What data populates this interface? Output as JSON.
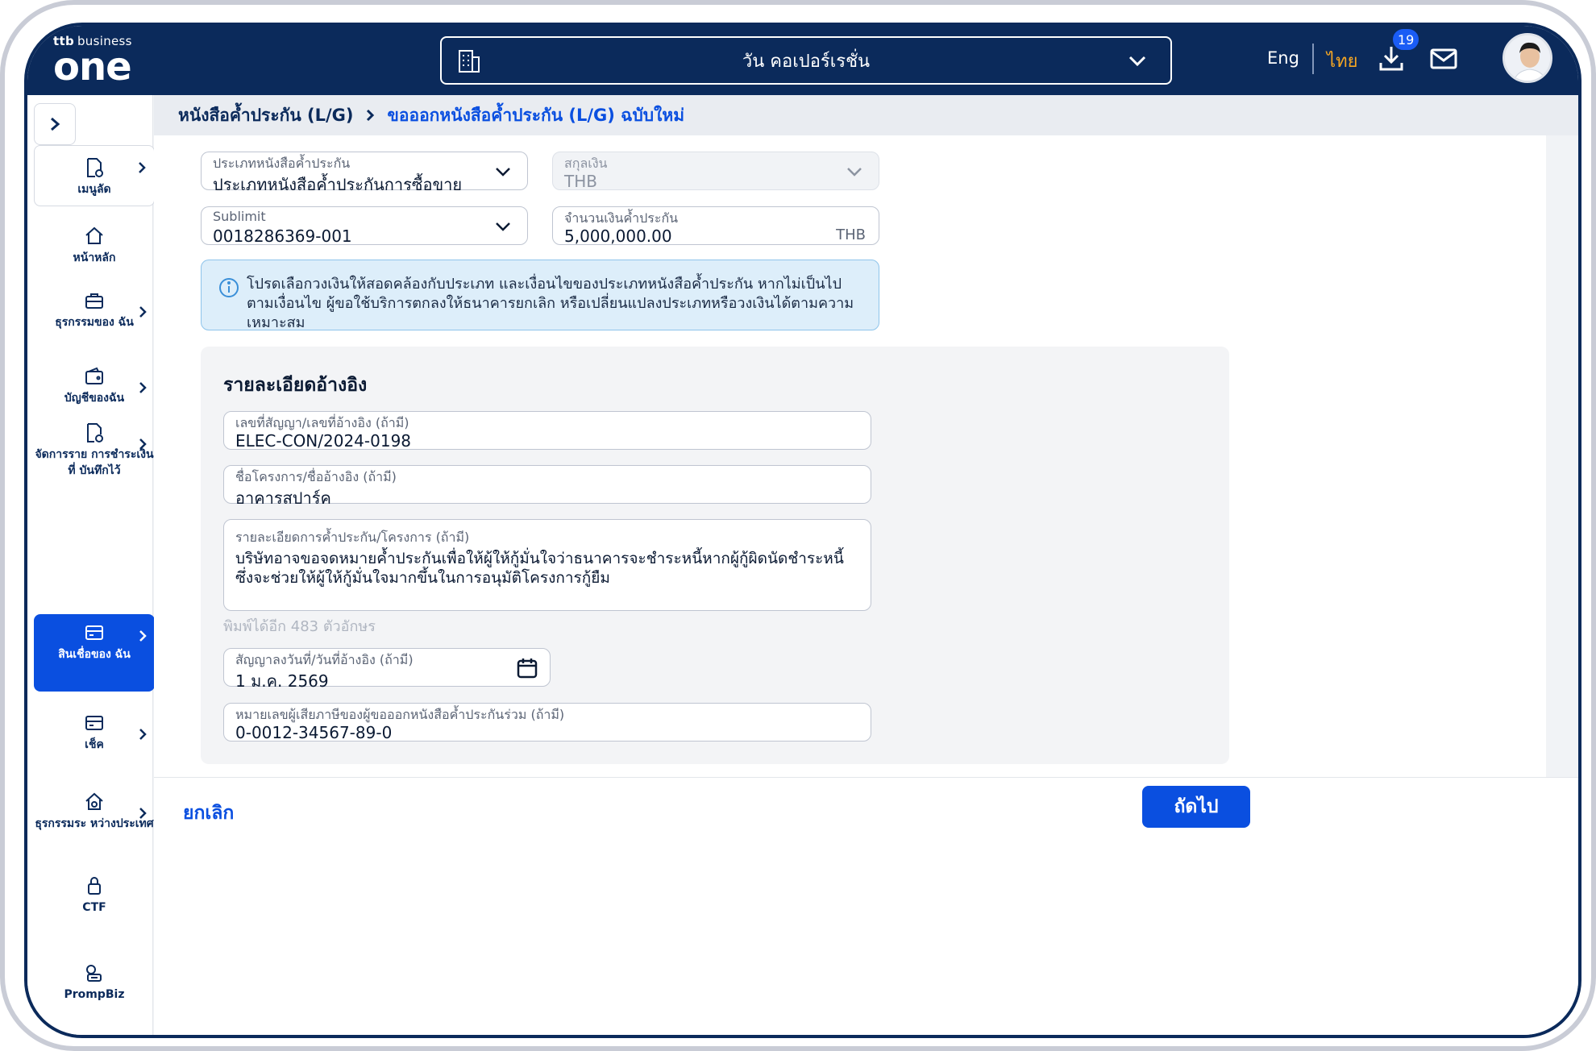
{
  "header": {
    "logo_top_mark": "ttb",
    "logo_top_text": "business",
    "logo_main": "one",
    "company_name": "วัน คอเปอร์เรชั่น",
    "lang_eng": "Eng",
    "lang_thai": "ไทย",
    "download_badge": "19"
  },
  "sidebar": {
    "items": [
      {
        "label": "เมนูลัด"
      },
      {
        "label": "หน้าหลัก"
      },
      {
        "label": "ธุรกรรมของ ฉัน"
      },
      {
        "label": "บัญชีของฉัน"
      },
      {
        "label": "จัดการราย การชำระเงินที่ บันทึกไว้"
      },
      {
        "label": "สินเชื่อของ ฉัน"
      },
      {
        "label": "เช็ค"
      },
      {
        "label": "ธุรกรรมระ หว่างประเทศ"
      },
      {
        "label": "CTF"
      },
      {
        "label": "PrompBiz"
      }
    ]
  },
  "breadcrumb": {
    "level1": "หนังสือค้ำประกัน (L/G)",
    "level2": "ขอออกหนังสือค้ำประกัน (L/G) ฉบับใหม่"
  },
  "form": {
    "lg_type": {
      "label": "ประเภทหนังสือค้ำประกัน",
      "value": "ประเภทหนังสือค้ำประกันการซื้อขาย"
    },
    "currency": {
      "label": "สกุลเงิน",
      "value": "THB"
    },
    "sublimit": {
      "label": "Sublimit",
      "value": "0018286369-001"
    },
    "amount": {
      "label": "จำนวนเงินค้ำประกัน",
      "value": "5,000,000.00",
      "suffix": "THB"
    },
    "info_text": "โปรดเลือกวงเงินให้สอดคล้องกับประเภท และเงื่อนไขของประเภทหนังสือค้ำประกัน หากไม่เป็นไปตามเงื่อนไข ผู้ขอใช้บริการตกลงให้ธนาคารยกเลิก หรือเปลี่ยนแปลงประเภทหรือวงเงินได้ตามความเหมาะสม"
  },
  "reference": {
    "title": "รายละเอียดอ้างอิง",
    "contract_no": {
      "label": "เลขที่สัญญา/เลขที่อ้างอิง (ถ้ามี)",
      "value": "ELEC-CON/2024-0198"
    },
    "project_name": {
      "label": "ชื่อโครงการ/ชื่ออ้างอิง (ถ้ามี)",
      "value": "อาคารสปาร์ค"
    },
    "details": {
      "label": "รายละเอียดการค้ำประกัน/โครงการ (ถ้ามี)",
      "value": "บริษัทอาจขอจดหมายค้ำประกันเพื่อให้ผู้ให้กู้มั่นใจว่าธนาคารจะชำระหนี้หากผู้กู้ผิดนัดชำระหนี้ซึ่งจะช่วยให้ผู้ให้กู้มั่นใจมากขึ้นในการอนุมัติโครงการกู้ยืม"
    },
    "char_counter": "พิมพ์ได้อีก 483 ตัวอักษร",
    "contract_date": {
      "label": "สัญญาลงวันที่/วันที่อ้างอิง (ถ้ามี)",
      "value": "1 ม.ค. 2569"
    },
    "tax_id": {
      "label": "หมายเลขผู้เสียภาษีของผู้ขอออกหนังสือค้ำประกันร่วม (ถ้ามี)",
      "value": "0-0012-34567-89-0"
    }
  },
  "footer": {
    "cancel": "ยกเลิก",
    "next": "ถัดไป"
  },
  "colors": {
    "navy": "#0b2a5b",
    "primary": "#0a4fe0",
    "accent_thai": "#f5a623",
    "info_bg": "#ddeefa"
  }
}
